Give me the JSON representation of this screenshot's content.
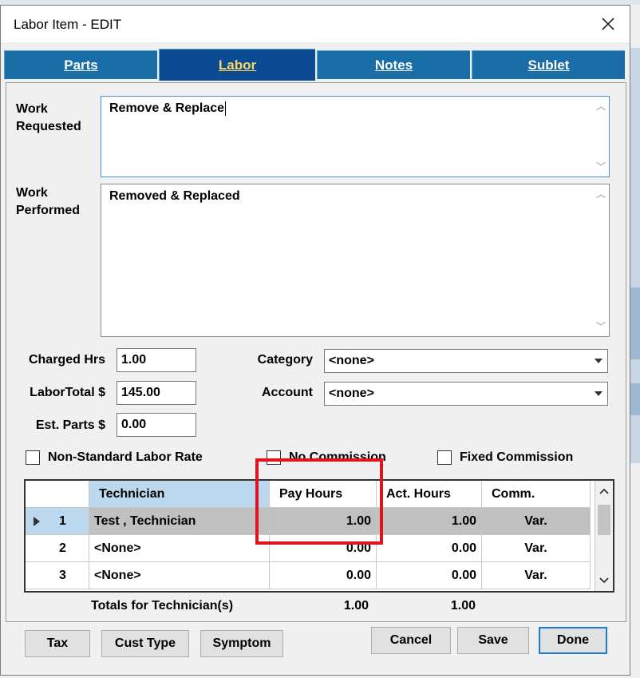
{
  "window": {
    "title": "Labor Item - EDIT"
  },
  "tabs": [
    {
      "label": "Parts",
      "active": false
    },
    {
      "label": "Labor",
      "active": true
    },
    {
      "label": "Notes",
      "active": false
    },
    {
      "label": "Sublet",
      "active": false
    }
  ],
  "form": {
    "work_requested_label": "Work Requested",
    "work_requested_value": "Remove & Replace",
    "work_performed_label": "Work Performed",
    "work_performed_value": "Removed & Replaced",
    "charged_hrs_label": "Charged Hrs",
    "charged_hrs_value": "1.00",
    "labor_total_label": "LaborTotal $",
    "labor_total_value": "145.00",
    "est_parts_label": "Est. Parts $",
    "est_parts_value": "0.00",
    "category_label": "Category",
    "category_value": "<none>",
    "account_label": "Account",
    "account_value": "<none>"
  },
  "checkboxes": [
    {
      "label": "Non-Standard Labor Rate",
      "checked": false
    },
    {
      "label": "No Commission",
      "checked": false
    },
    {
      "label": "Fixed Commission",
      "checked": false
    }
  ],
  "grid": {
    "columns": [
      "Technician",
      "Pay Hours",
      "Act. Hours",
      "Comm."
    ],
    "rows": [
      {
        "num": "1",
        "technician": "Test , Technician",
        "pay_hours": "1.00",
        "act_hours": "1.00",
        "comm": "Var."
      },
      {
        "num": "2",
        "technician": "<None>",
        "pay_hours": "0.00",
        "act_hours": "0.00",
        "comm": "Var."
      },
      {
        "num": "3",
        "technician": "<None>",
        "pay_hours": "0.00",
        "act_hours": "0.00",
        "comm": "Var."
      }
    ],
    "totals_label": "Totals for Technician(s)",
    "totals_pay": "1.00",
    "totals_act": "1.00"
  },
  "buttons": {
    "tax": "Tax",
    "cust_type": "Cust Type",
    "symptom": "Symptom",
    "cancel": "Cancel",
    "save": "Save",
    "done": "Done"
  },
  "colors": {
    "tab_blue": "#1a6ea8",
    "tab_active": "#0b4b94",
    "tab_active_text": "#ffd75a",
    "highlight_red": "#e0141e"
  }
}
